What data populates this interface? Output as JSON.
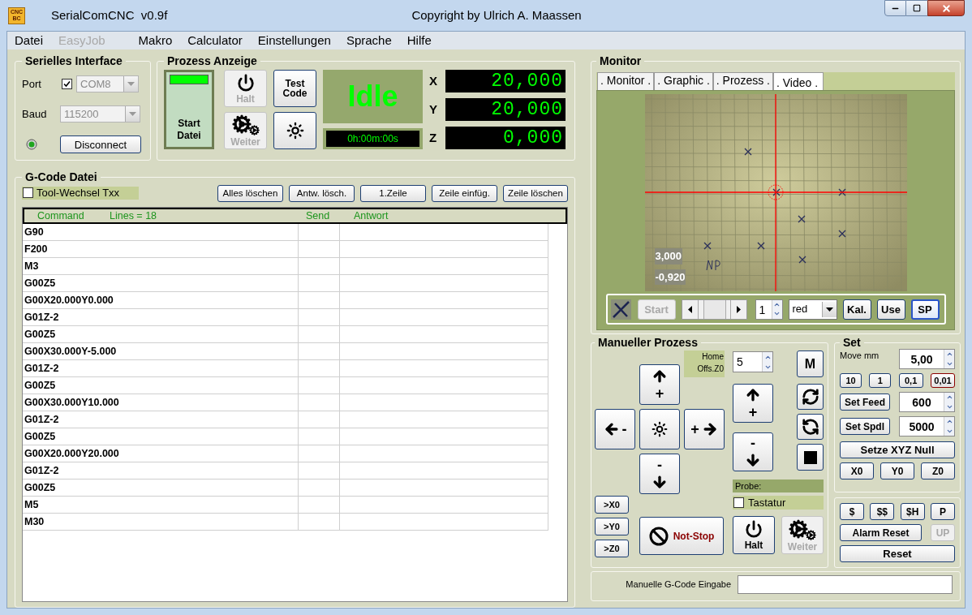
{
  "window": {
    "logo": [
      "CNC",
      "BC"
    ],
    "title": "SerialComCNC  v0.9f",
    "copyright": "Copyright by Ulrich A. Maassen"
  },
  "menu": [
    {
      "label": "Datei",
      "disabled": false
    },
    {
      "label": "EasyJob",
      "disabled": true
    },
    {
      "label": "Makro",
      "disabled": false
    },
    {
      "label": "Calculator",
      "disabled": false
    },
    {
      "label": "Einstellungen",
      "disabled": false
    },
    {
      "label": "Sprache",
      "disabled": false
    },
    {
      "label": "Hilfe",
      "disabled": false
    }
  ],
  "serial": {
    "title": "Serielles Interface",
    "port_label": "Port",
    "port_checked": true,
    "port": {
      "value": "COM8",
      "disabled": true
    },
    "baud_label": "Baud",
    "baud": {
      "value": "115200",
      "disabled": true
    },
    "connect_button": "Disconnect"
  },
  "process": {
    "title": "Prozess Anzeige",
    "start": "Start Datei",
    "halt": {
      "label": "Halt",
      "disabled": true
    },
    "weiter": {
      "label": "Weiter",
      "disabled": true
    },
    "test": "Test Code",
    "status": "Idle",
    "timer": "0h:00m:00s",
    "axes": [
      {
        "axis": "X",
        "value": "20,000"
      },
      {
        "axis": "Y",
        "value": "20,000"
      },
      {
        "axis": "Z",
        "value": "0,000"
      }
    ]
  },
  "gcode": {
    "title": "G-Code Datei",
    "tool_change": {
      "label": "Tool-Wechsel Txx",
      "checked": false
    },
    "buttons": [
      "Alles löschen",
      "Antw. lösch.",
      "1.Zeile",
      "Zeile einfüg.",
      "Zeile löschen"
    ],
    "columns": [
      "Command",
      "Lines = 18",
      "Send",
      "Antwort"
    ],
    "rows": [
      "G90",
      "F200",
      "M3",
      "G00Z5",
      "G00X20.000Y0.000",
      "G01Z-2",
      "G00Z5",
      "G00X30.000Y-5.000",
      "G01Z-2",
      "G00Z5",
      "G00X30.000Y10.000",
      "G01Z-2",
      "G00Z5",
      "G00X20.000Y20.000",
      "G01Z-2",
      "G00Z5",
      "M5",
      "M30"
    ]
  },
  "monitor": {
    "title": "Monitor",
    "tabs": [
      {
        "label": ". Monitor .",
        "selected": false
      },
      {
        "label": ". Graphic .",
        "selected": false
      },
      {
        "label": ". Prozess .",
        "selected": false
      },
      {
        "label": ". Video .",
        "selected": true
      }
    ],
    "overlay": [
      "3,000",
      "-0,920"
    ],
    "start": {
      "label": "Start",
      "disabled": true
    },
    "spin": "1",
    "color_select": "red",
    "buttons": [
      {
        "label": "Kal.",
        "selected": false
      },
      {
        "label": "Use",
        "selected": false
      },
      {
        "label": "SP",
        "selected": true
      }
    ]
  },
  "manual": {
    "title": "Manueller Prozess",
    "home": "Home",
    "offset": "Offs.Z0",
    "step": "5",
    "plus": "+",
    "minus": "-",
    "m_button": "M",
    "probe": "Probe:",
    "keyboard": {
      "label": "Tastatur",
      "checked": false
    },
    "goto": [
      ">X0",
      ">Y0",
      ">Z0"
    ],
    "stop": "Not-Stop",
    "halt": {
      "label": "Halt",
      "disabled": false
    },
    "weiter": {
      "label": "Weiter",
      "disabled": true
    }
  },
  "set": {
    "title": "Set",
    "move_label": "Move mm",
    "move_value": "5,00",
    "steps": [
      {
        "label": "10",
        "selected": false
      },
      {
        "label": "1",
        "selected": false
      },
      {
        "label": "0,1",
        "selected": false
      },
      {
        "label": "0,01",
        "selected": true
      }
    ],
    "feed": {
      "label": "Set Feed",
      "value": "600"
    },
    "spindle": {
      "label": "Set Spdl",
      "value": "5000"
    },
    "zero": "Setze XYZ Null",
    "zero_axes": [
      "X0",
      "Y0",
      "Z0"
    ]
  },
  "commands": {
    "buttons": [
      "$",
      "$$",
      "$H",
      "P"
    ],
    "alarm": "Alarm Reset",
    "up": {
      "label": "UP",
      "disabled": true
    },
    "reset": "Reset"
  },
  "manual_input": {
    "label": "Manuelle G-Code Eingabe"
  }
}
